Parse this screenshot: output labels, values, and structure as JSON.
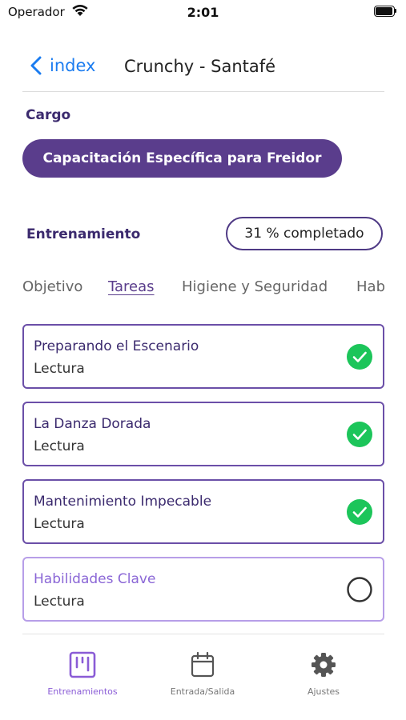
{
  "status_bar": {
    "carrier": "Operador",
    "time": "2:01"
  },
  "nav": {
    "back_label": "index",
    "title": "Crunchy - Santafé"
  },
  "cargo": {
    "label": "Cargo",
    "value": "Capacitación Específica para Freidor"
  },
  "training": {
    "label": "Entrenamiento",
    "progress": "31 % completado"
  },
  "tabs": [
    {
      "label": "Objetivo"
    },
    {
      "label": "Tareas"
    },
    {
      "label": "Higiene y Seguridad"
    },
    {
      "label": "Habilidades"
    }
  ],
  "active_tab": "Tareas",
  "tasks": [
    {
      "title": "Preparando el Escenario",
      "type": "Lectura",
      "completed": true
    },
    {
      "title": "La Danza Dorada",
      "type": "Lectura",
      "completed": true
    },
    {
      "title": "Mantenimiento Impecable",
      "type": "Lectura",
      "completed": true
    },
    {
      "title": "Habilidades Clave",
      "type": "Lectura",
      "completed": false
    }
  ],
  "tab_bar": [
    {
      "label": "Entrenamientos",
      "icon": "training-board-icon",
      "active": true
    },
    {
      "label": "Entrada/Salida",
      "icon": "calendar-icon",
      "active": false
    },
    {
      "label": "Ajustes",
      "icon": "gear-icon",
      "active": false
    }
  ],
  "colors": {
    "accent": "#5a3d8c",
    "link": "#1b7cf0",
    "completed": "#1cc55a",
    "tab_active": "#8a5cd6"
  }
}
